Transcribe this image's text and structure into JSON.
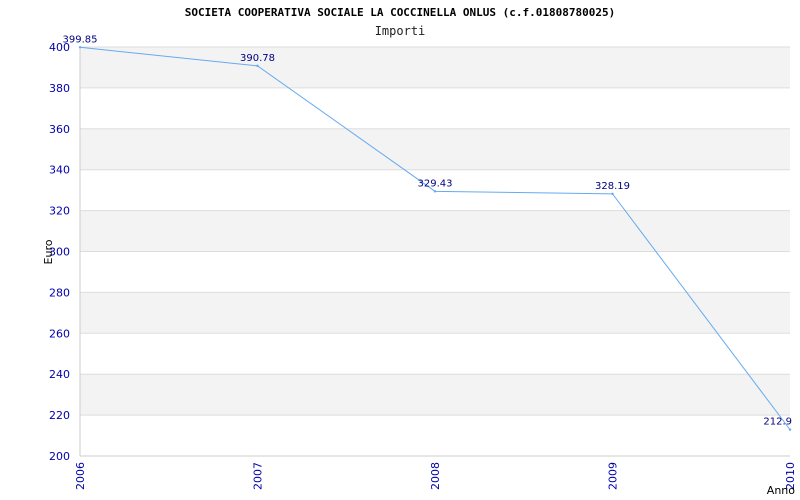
{
  "chart_data": {
    "type": "line",
    "title": "SOCIETA COOPERATIVA SOCIALE LA COCCINELLA ONLUS (c.f.01808780025)",
    "subtitle": "Importi",
    "xlabel": "Anno",
    "ylabel": "Euro",
    "x": [
      "2006",
      "2007",
      "2008",
      "2009",
      "2010"
    ],
    "series": [
      {
        "values": [
          399.85,
          390.78,
          329.43,
          328.19,
          212.9
        ]
      }
    ],
    "data_labels": [
      "399.85",
      "390.78",
      "329.43",
      "328.19",
      "212.9"
    ],
    "ylim": [
      200,
      400
    ],
    "yticks": [
      200,
      220,
      240,
      260,
      280,
      300,
      320,
      340,
      360,
      380,
      400
    ],
    "grid": true,
    "colors": {
      "line": "#66aaee",
      "band": "#f3f3f3",
      "tick": "#0000aa",
      "label": "#000080"
    }
  }
}
